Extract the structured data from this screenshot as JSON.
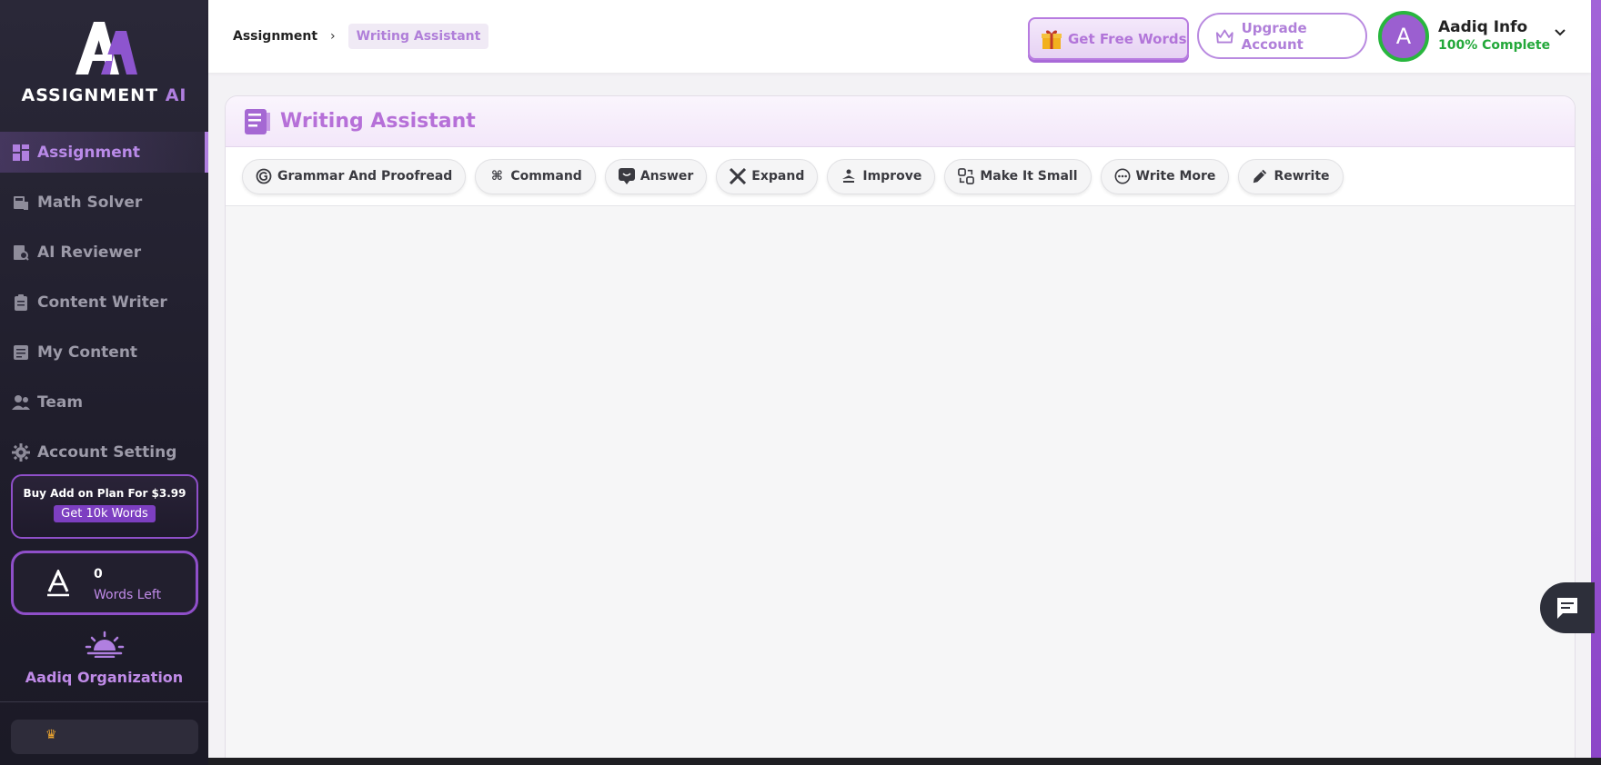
{
  "brand": {
    "name_main": "ASSIGNMENT",
    "name_accent": "AI"
  },
  "sidebar": {
    "items": [
      {
        "label": "Assignment",
        "icon": "dashboard-icon",
        "active": true
      },
      {
        "label": "Math Solver",
        "icon": "math-icon"
      },
      {
        "label": "AI Reviewer",
        "icon": "reviewer-icon"
      },
      {
        "label": "Content Writer",
        "icon": "clipboard-icon"
      },
      {
        "label": "My Content",
        "icon": "document-icon"
      },
      {
        "label": "Team",
        "icon": "team-icon"
      },
      {
        "label": "Account Setting",
        "icon": "gear-icon"
      }
    ],
    "promo": {
      "title": "Buy Add on Plan For $3.99",
      "button": "Get 10k Words"
    },
    "words": {
      "count": "0",
      "label": "Words Left"
    },
    "organization": {
      "name": "Aadiq Organization"
    }
  },
  "header": {
    "breadcrumb": {
      "root": "Assignment",
      "current": "Writing Assistant"
    },
    "free_words_label": "Get Free Words",
    "upgrade_label": "Upgrade Account",
    "user": {
      "initial": "A",
      "name": "Aadiq Info",
      "status": "100% Complete"
    }
  },
  "main": {
    "title": "Writing Assistant",
    "tools": [
      {
        "label": "Grammar And Proofread",
        "icon": "grammar-icon"
      },
      {
        "label": "Command",
        "icon": "command-icon"
      },
      {
        "label": "Answer",
        "icon": "answer-icon"
      },
      {
        "label": "Expand",
        "icon": "expand-icon"
      },
      {
        "label": "Improve",
        "icon": "improve-icon"
      },
      {
        "label": "Make It Small",
        "icon": "shrink-icon"
      },
      {
        "label": "Write More",
        "icon": "write-more-icon"
      },
      {
        "label": "Rewrite",
        "icon": "pencil-icon"
      }
    ]
  },
  "colors": {
    "accent": "#b07fe0",
    "sidebar_bg": "#1f1d2b",
    "success": "#23a83a"
  }
}
